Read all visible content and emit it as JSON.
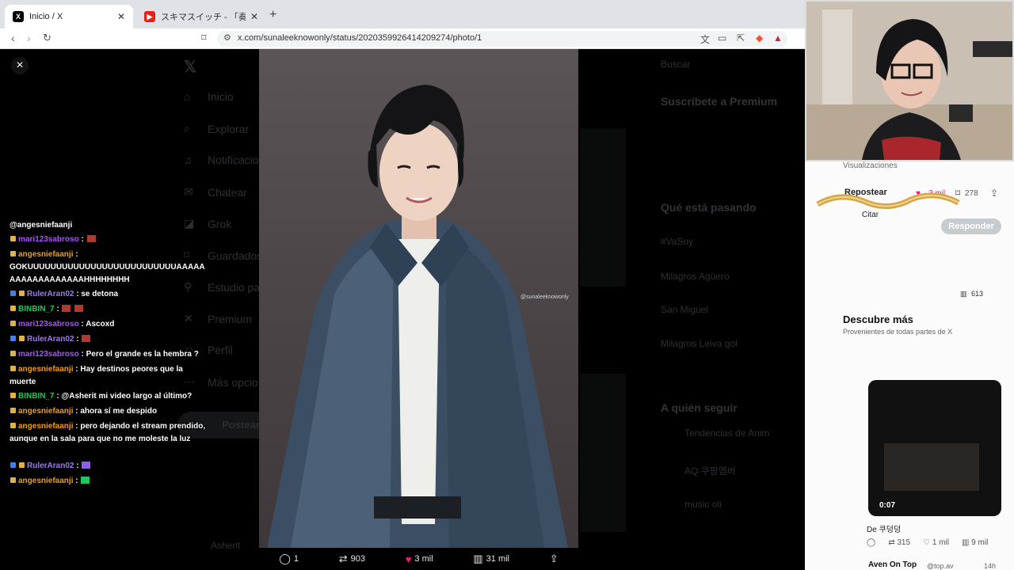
{
  "browser": {
    "tabs": [
      {
        "title": "Inicio / X",
        "active": true
      },
      {
        "title": "スキマスイッチ - 「奏（かなで）」Music V",
        "active": false
      }
    ],
    "new_tab": "+",
    "url": "x.com/sunaleeknowonly/status/2020359926414209274/photo/1"
  },
  "background_page": {
    "nav": [
      "Inicio",
      "Explorar",
      "Notificacio",
      "Chatear",
      "Grok",
      "Guardados",
      "Estudio pa",
      "Premium",
      "Perfil",
      "Más opcio"
    ],
    "post_button": "Postear",
    "right": {
      "search": "Buscar",
      "premium_title": "Suscríbete a Premium",
      "trending_title": "Qué está pasando",
      "trends": [
        "#VaSoy",
        "Milagros Agüero",
        "San Miguel",
        "Milagros Leiva gol"
      ],
      "who_to_follow": "A quién seguir",
      "follow": [
        "Tendencias de Anim",
        "AQ 쿠팡멤버",
        "music oli"
      ]
    },
    "bottom_user": "Asherit"
  },
  "viewer": {
    "close": "×",
    "watermark": "@sunaleeknowonly",
    "actions": {
      "replies": "1",
      "reposts": "903",
      "likes": "3 mil",
      "views": "31 mil"
    }
  },
  "stream": {
    "overlay_top": "Visualizaciones",
    "repost_label": "Repostear",
    "likes_small": "3 mil",
    "bookmarks": "278",
    "cite": "Citar",
    "respond": "Responder",
    "discover": "Descubre más",
    "discover_sub": "Provenientes de todas partes de X",
    "video_time": "0:07",
    "video_by": "De 쿠덩덩",
    "bottom_stats": [
      "315",
      "1 mil",
      "9 mil"
    ],
    "bottom_user": "Aven On Top",
    "bottom_handle": "@top.av",
    "bottom_time": "14h",
    "chat": [
      {
        "user": "@angesniefaanji",
        "text": ""
      },
      {
        "user": "mari123sabroso",
        "text": ""
      },
      {
        "user": "angesniefaanji",
        "text": "GOKUUUUUUUUUUUUUUUUUUUUUUUUUUAAAAAAAAAAAAAAAAAAHHHHHHHH"
      },
      {
        "user": "RulerAran02",
        "text": "se detona"
      },
      {
        "user": "BINBIN_7",
        "text": ""
      },
      {
        "user": "mari123sabroso",
        "text": "Ascoxd"
      },
      {
        "user": "RulerAran02",
        "text": ""
      },
      {
        "user": "mari123sabroso",
        "text": "Pero el grande es la hembra ?"
      },
      {
        "user": "angesniefaanji",
        "text": "Hay destinos peores que la muerte"
      },
      {
        "user": "BINBIN_7",
        "text": "@Asherit mi video largo al último?"
      },
      {
        "user": "angesniefaanji",
        "text": "ahora sí me despido"
      },
      {
        "user": "angesniefaanji",
        "text": "pero dejando el stream prendido, aunque en la sala para que no me moleste la luz"
      },
      {
        "user": "RulerAran02",
        "text": ""
      },
      {
        "user": "angesniefaanji",
        "text": ""
      }
    ],
    "misc": {
      "views_613": "613"
    }
  },
  "colors": {
    "like": "#f91880",
    "chrome": "#dfe3e8"
  }
}
